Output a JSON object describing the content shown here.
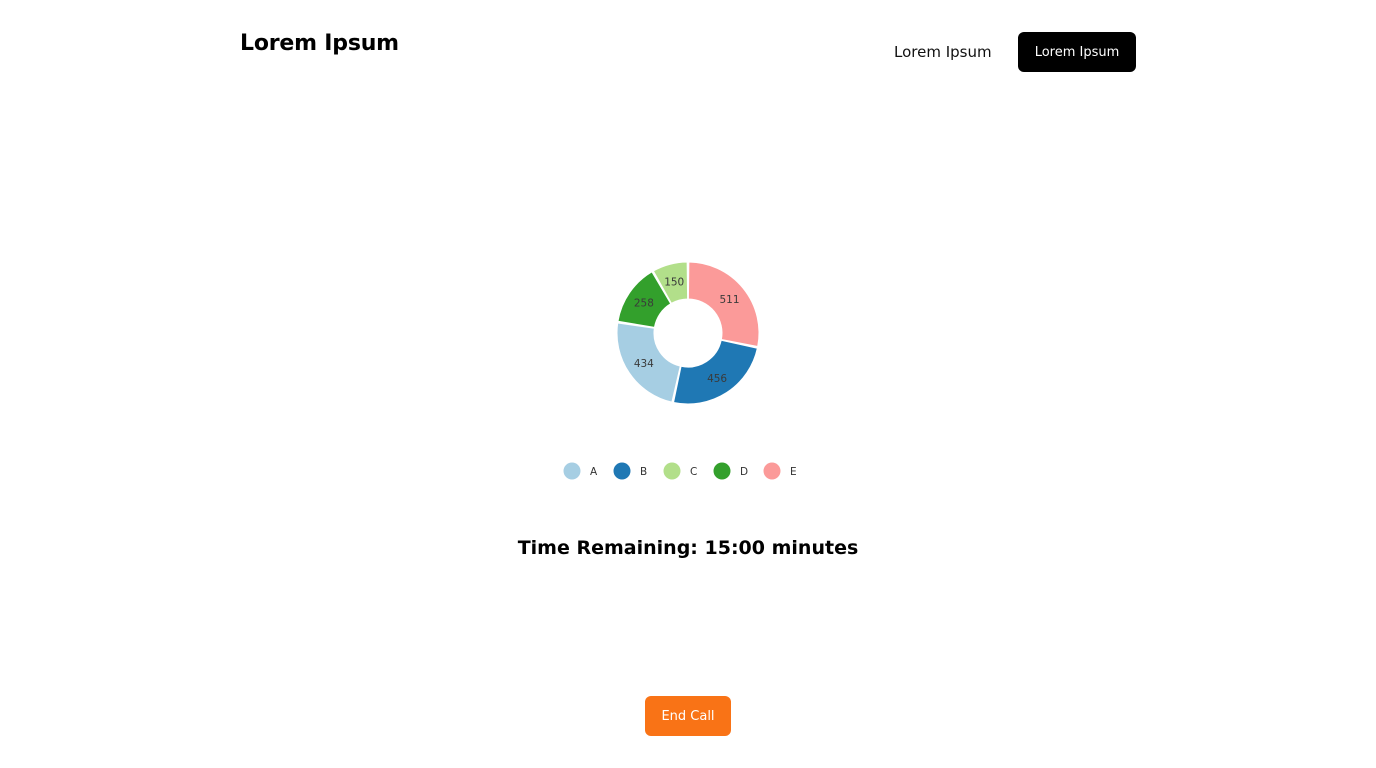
{
  "header": {
    "brand": "Lorem Ipsum",
    "nav_link": "Lorem Ipsum",
    "nav_button": "Lorem Ipsum"
  },
  "chart_data": {
    "type": "pie",
    "variant": "donut",
    "categories": [
      "A",
      "B",
      "C",
      "D",
      "E"
    ],
    "values": [
      434,
      456,
      150,
      258,
      511
    ],
    "draw_order": [
      "E",
      "B",
      "A",
      "D",
      "C"
    ],
    "colors": {
      "A": "#a6cee3",
      "B": "#1f78b4",
      "C": "#b2df8a",
      "D": "#33a02c",
      "E": "#fb9a99"
    },
    "legend_position": "bottom",
    "show_value_labels": true
  },
  "timer": {
    "label": "Time Remaining:",
    "value": "15:00",
    "unit": "minutes"
  },
  "actions": {
    "end_call": "End Call"
  },
  "colors": {
    "primary_button": "#000000",
    "end_call": "#f97316"
  }
}
